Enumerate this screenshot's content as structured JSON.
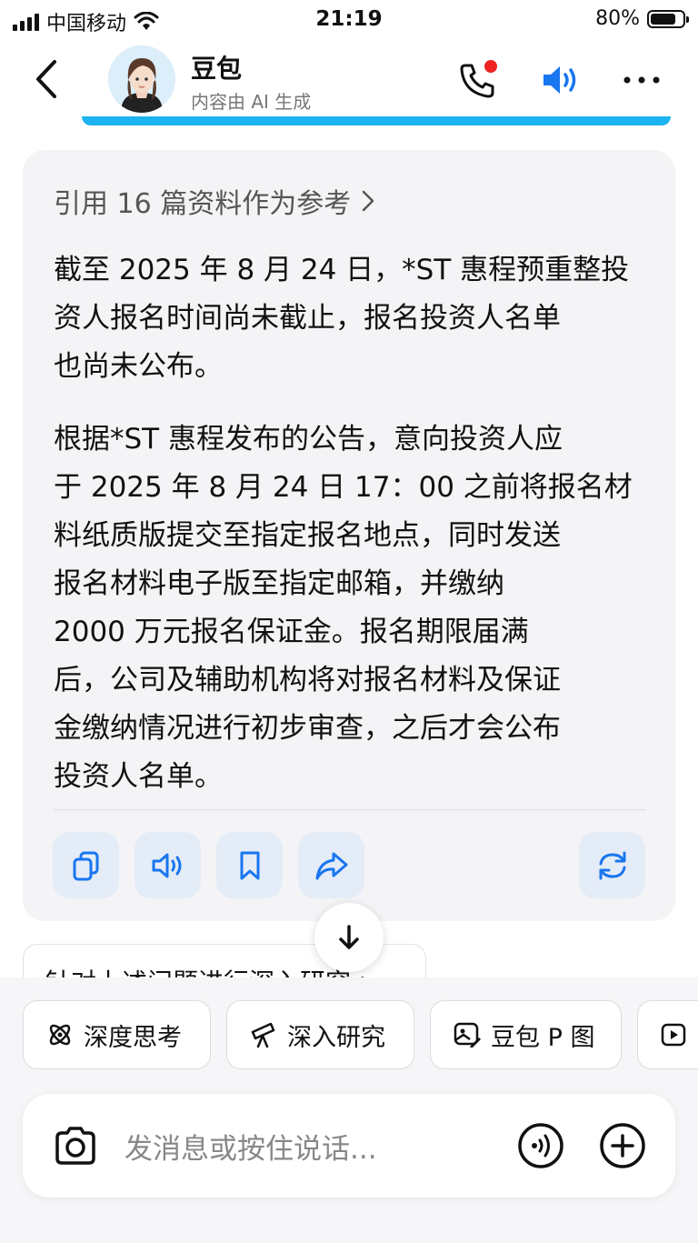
{
  "status_bar": {
    "carrier": "中国移动",
    "time": "21:19",
    "battery": "80%",
    "battery_level": 0.8
  },
  "header": {
    "title": "豆包",
    "subtitle": "内容由 AI 生成",
    "icons": [
      "back-chevron-icon",
      "phone-icon",
      "speaker-icon",
      "more-icon"
    ]
  },
  "message": {
    "references": "引用 16 篇资料作为参考",
    "paragraphs": [
      [
        "截至 2025 年 8 月 24 日，*ST 惠程预重整投",
        "资人报名时间尚未截止，报名投资人名单",
        "也尚未公布。"
      ],
      [
        "根据*ST 惠程发布的公告，意向投资人应",
        "于 2025 年 8 月 24 日 17：00 之前将报名材",
        "料纸质版提交至指定报名地点，同时发送",
        "报名材料电子版至指定邮箱，并缴纳",
        "2000 万元报名保证金。报名期限届满",
        "后，公司及辅助机构将对报名材料及保证",
        "金缴纳情况进行初步审查，之后才会公布",
        "投资人名单。"
      ]
    ],
    "actions": [
      "copy-icon",
      "read-aloud-icon",
      "bookmark-icon",
      "share-icon",
      "regenerate-icon"
    ]
  },
  "suggestion": "针对上述问题进行深入研究 >",
  "chips": [
    {
      "label": "深度思考",
      "icon": "atom-icon"
    },
    {
      "label": "深入研究",
      "icon": "telescope-icon"
    },
    {
      "label": "豆包 P 图",
      "icon": "image-edit-icon"
    },
    {
      "label": "",
      "icon": "video-icon"
    }
  ],
  "input": {
    "placeholder": "发消息或按住说话..."
  },
  "colors": {
    "accent": "#1976f0",
    "accent_line": "#1cb3ee",
    "card_bg": "#f4f4f6",
    "action_bg": "#e4ecf7",
    "notification_dot": "#ee2222"
  }
}
